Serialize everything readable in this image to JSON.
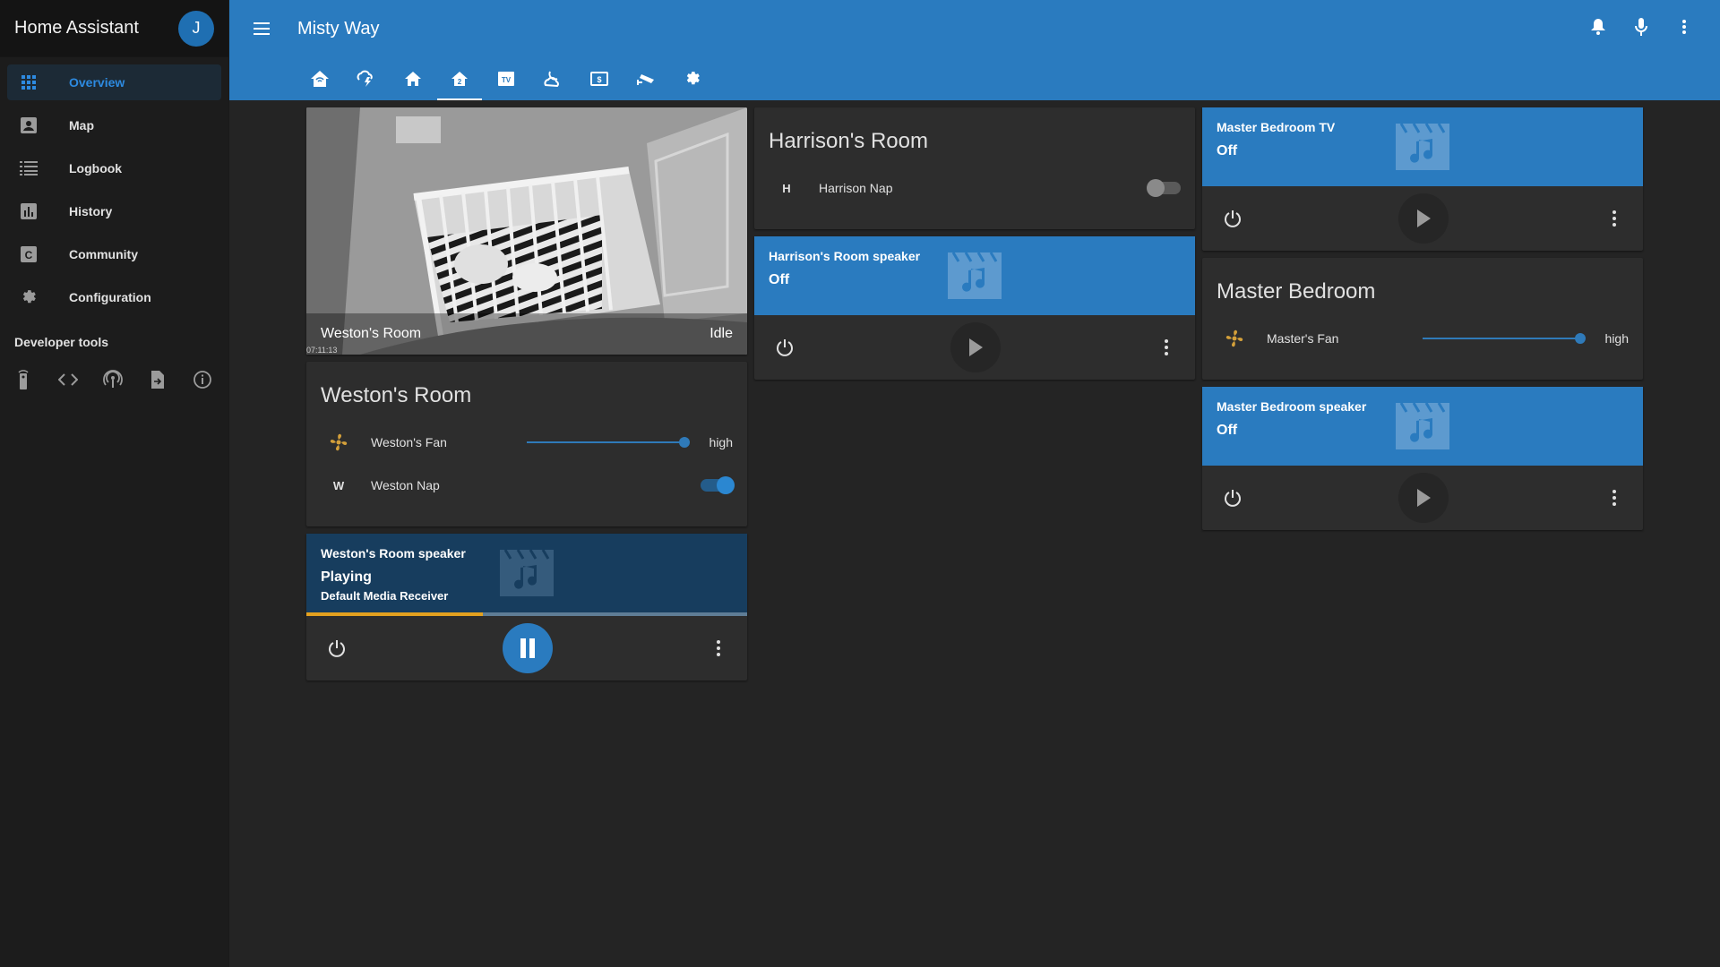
{
  "sidebar": {
    "title": "Home Assistant",
    "avatar_initial": "J",
    "items": [
      {
        "label": "Overview",
        "icon": "apps-icon"
      },
      {
        "label": "Map",
        "icon": "account-box-icon"
      },
      {
        "label": "Logbook",
        "icon": "list-icon"
      },
      {
        "label": "History",
        "icon": "chart-bar-icon"
      },
      {
        "label": "Community",
        "icon": "community-icon"
      },
      {
        "label": "Configuration",
        "icon": "gear-icon"
      }
    ],
    "developer_label": "Developer tools",
    "dev_tools": [
      "remote-icon",
      "code-icon",
      "podcast-icon",
      "file-export-icon",
      "info-icon"
    ]
  },
  "header": {
    "title": "Misty Way",
    "tabs": [
      "home-automation-icon",
      "weather-lightning-icon",
      "home-icon",
      "home-variant-icon",
      "tv-icon",
      "weather-night-icon",
      "cash-icon",
      "cctv-icon",
      "gear-icon"
    ],
    "active_tab": 3,
    "actions": [
      "bell-icon",
      "microphone-icon",
      "more-vert-icon"
    ]
  },
  "camera": {
    "name": "Weston's Room",
    "state": "Idle",
    "timestamp": "07:11:13"
  },
  "weston_room": {
    "title": "Weston's Room",
    "fan": {
      "name": "Weston's Fan",
      "state": "high",
      "level": 1.0
    },
    "nap": {
      "icon_letter": "W",
      "name": "Weston Nap",
      "on": true
    }
  },
  "weston_speaker": {
    "name": "Weston's Room speaker",
    "state": "Playing",
    "source": "Default Media Receiver",
    "progress": 0.4
  },
  "harrison_room": {
    "title": "Harrison's Room",
    "nap": {
      "icon_letter": "H",
      "name": "Harrison Nap",
      "on": false
    }
  },
  "harrison_speaker": {
    "name": "Harrison's Room speaker",
    "state": "Off"
  },
  "master_tv": {
    "name": "Master Bedroom TV",
    "state": "Off"
  },
  "master_bedroom": {
    "title": "Master Bedroom",
    "fan": {
      "name": "Master's Fan",
      "state": "high",
      "level": 1.0
    }
  },
  "master_speaker": {
    "name": "Master Bedroom speaker",
    "state": "Off"
  },
  "colors": {
    "primary": "#2a7bbf",
    "accent": "#e3a11f",
    "fan_icon": "#d4a03a"
  }
}
